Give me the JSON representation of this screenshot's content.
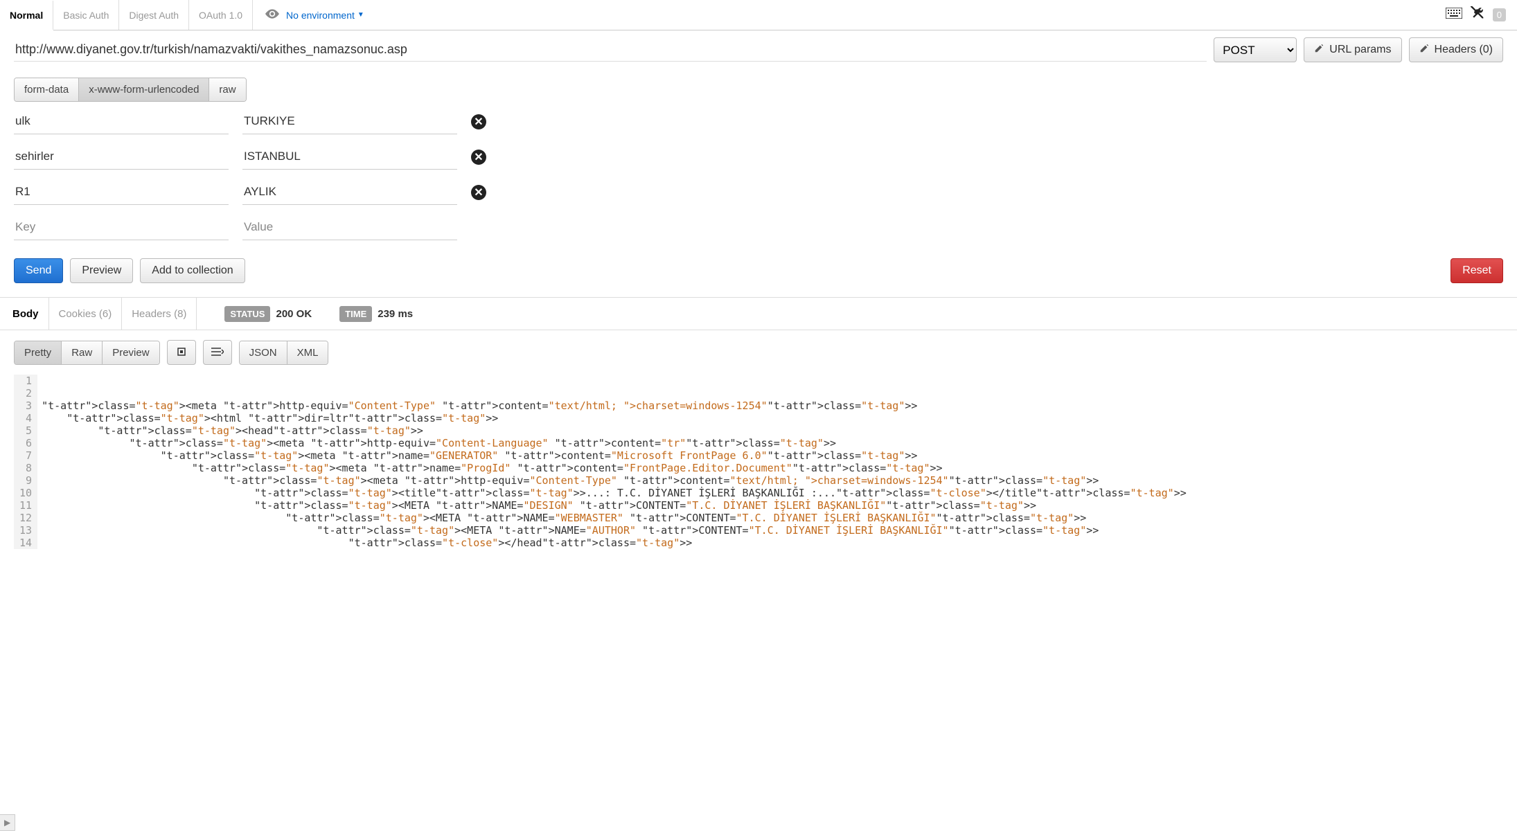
{
  "authTabs": {
    "normal": "Normal",
    "basic": "Basic Auth",
    "digest": "Digest Auth",
    "oauth": "OAuth 1.0"
  },
  "env": {
    "label": "No environment"
  },
  "topRight": {
    "badge": "0"
  },
  "request": {
    "url": "http://www.diyanet.gov.tr/turkish/namazvakti/vakithes_namazsonuc.asp",
    "method": "POST",
    "urlParamsBtn": "URL params",
    "headersBtn": "Headers (0)"
  },
  "bodyTypes": {
    "formdata": "form-data",
    "urlenc": "x-www-form-urlencoded",
    "raw": "raw"
  },
  "params": [
    {
      "key": "ulk",
      "value": "TURKIYE"
    },
    {
      "key": "sehirler",
      "value": "ISTANBUL"
    },
    {
      "key": "R1",
      "value": "AYLIK"
    }
  ],
  "paramPlaceholders": {
    "key": "Key",
    "value": "Value"
  },
  "actions": {
    "send": "Send",
    "preview": "Preview",
    "add": "Add to collection",
    "reset": "Reset"
  },
  "respTabs": {
    "body": "Body",
    "cookies": "Cookies (6)",
    "headers": "Headers (8)"
  },
  "status": {
    "label": "STATUS",
    "value": "200 OK"
  },
  "time": {
    "label": "TIME",
    "value": "239 ms"
  },
  "viewModes": {
    "pretty": "Pretty",
    "raw": "Raw",
    "preview": "Preview",
    "json": "JSON",
    "xml": "XML"
  },
  "code": {
    "lines": 14,
    "content": [
      "",
      "",
      "<meta http-equiv=\"Content-Type\" content=\"text/html; charset=windows-1254\">",
      "    <html dir=ltr>",
      "         <head>",
      "              <meta http-equiv=\"Content-Language\" content=\"tr\">",
      "                   <meta name=\"GENERATOR\" content=\"Microsoft FrontPage 6.0\">",
      "                        <meta name=\"ProgId\" content=\"FrontPage.Editor.Document\">",
      "                             <meta http-equiv=\"Content-Type\" content=\"text/html; charset=windows-1254\">",
      "                                  <title>...: T.C. DİYANET İŞLERİ BAŞKANLIĞI :...</title>",
      "                                  <META NAME=\"DESIGN\" CONTENT=\"T.C. DİYANET İŞLERİ BAŞKANLIĞI\">",
      "                                       <META NAME=\"WEBMASTER\" CONTENT=\"T.C. DİYANET İŞLERİ BAŞKANLIĞI\">",
      "                                            <META NAME=\"AUTHOR\" CONTENT=\"T.C. DİYANET İŞLERİ BAŞKANLIĞI\">",
      "                                                 </head>"
    ]
  }
}
